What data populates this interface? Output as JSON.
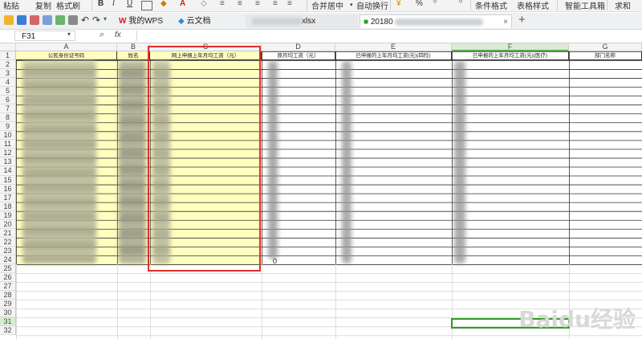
{
  "ribbon": {
    "paste": "粘贴",
    "copy": "复制",
    "format_painter": "格式刷",
    "bold": "B",
    "italic": "I",
    "underline": "U",
    "font_color": "A",
    "merge_center": "合并居中",
    "wrap_text": "自动换行",
    "percent": "%",
    "cond_format": "条件格式",
    "table_style": "表格样式",
    "smart_toolbox": "智能工具箱",
    "sum": "求和"
  },
  "tabs": {
    "wps": "我的WPS",
    "cloud_docs": "云文档",
    "file1_suffix": "xlsx",
    "file2_prefix": "20180",
    "add": "+",
    "close": "×"
  },
  "formula_bar": {
    "cell_ref": "F31",
    "fx": "fx"
  },
  "columns": [
    "A",
    "B",
    "C",
    "D",
    "E",
    "F",
    "G"
  ],
  "header_row": [
    "公民身份证号码",
    "姓名",
    "网上申报上年月均工资（元）",
    "原月均工资（元）",
    "已申报的上年月均工资(元)(四险)",
    "已申报的上年月均工资(元)(医疗)",
    "部门名称"
  ],
  "rows": [
    "1",
    "2",
    "3",
    "4",
    "5",
    "6",
    "7",
    "8",
    "9",
    "10",
    "11",
    "12",
    "13",
    "14",
    "15",
    "16",
    "17",
    "18",
    "19",
    "20",
    "21",
    "22",
    "23",
    "24",
    "25",
    "26",
    "27",
    "28",
    "29",
    "30",
    "31",
    "32"
  ],
  "cell_d24": "0",
  "watermark": "Baidu经验",
  "colors": {
    "accent_green": "#2f9a24",
    "highlight_yellow": "#ffffc0",
    "red_box": "#e0302a"
  }
}
